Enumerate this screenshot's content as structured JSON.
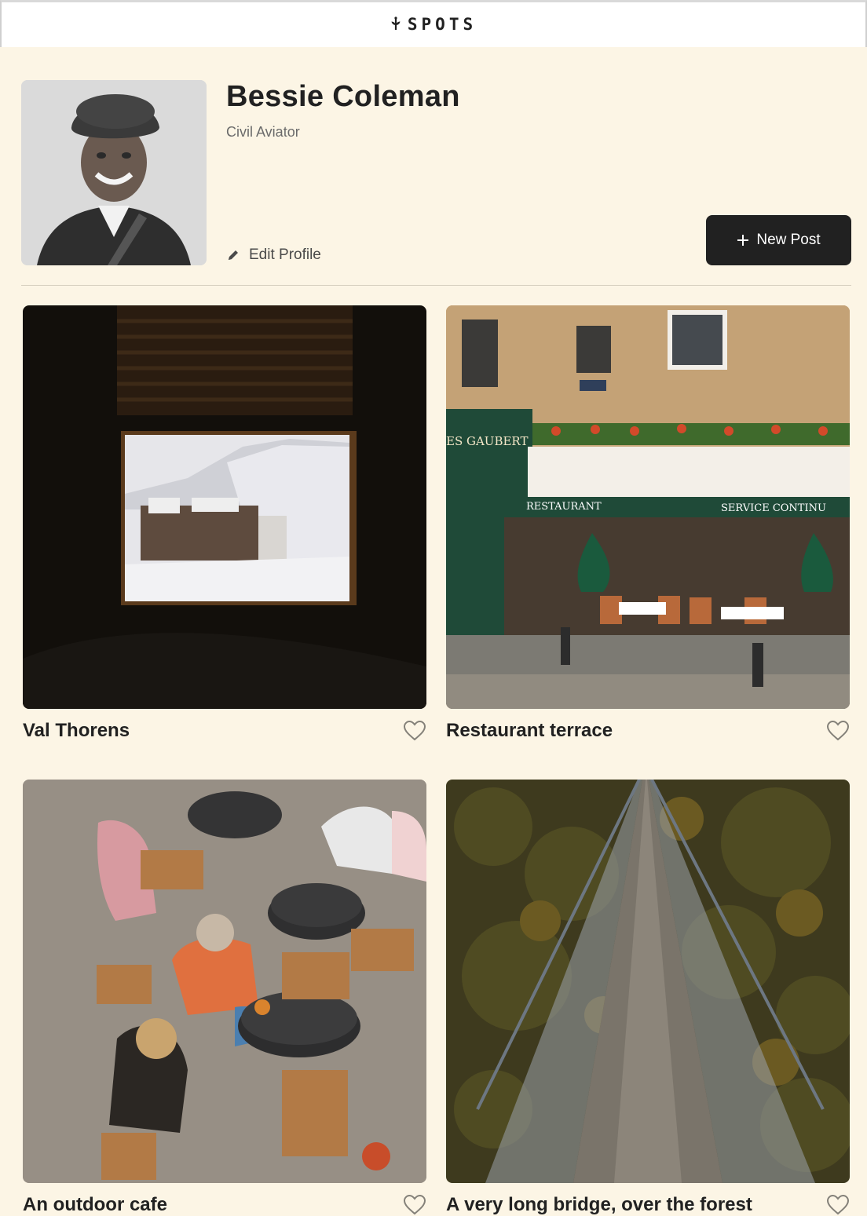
{
  "header": {
    "logo_text": "SPOTS",
    "logo_icon": "sprout-icon"
  },
  "profile": {
    "name": "Bessie Coleman",
    "role": "Civil Aviator",
    "edit_label": "Edit Profile",
    "new_post_label": "New Post"
  },
  "cards": [
    {
      "title": "Val Thorens",
      "liked": false
    },
    {
      "title": "Restaurant terrace",
      "liked": false
    },
    {
      "title": "An outdoor cafe",
      "liked": false
    },
    {
      "title": "A very long bridge, over the forest",
      "liked": false
    }
  ],
  "colors": {
    "background": "#FCF5E5",
    "dark": "#212121",
    "muted": "#6b6b6b"
  }
}
